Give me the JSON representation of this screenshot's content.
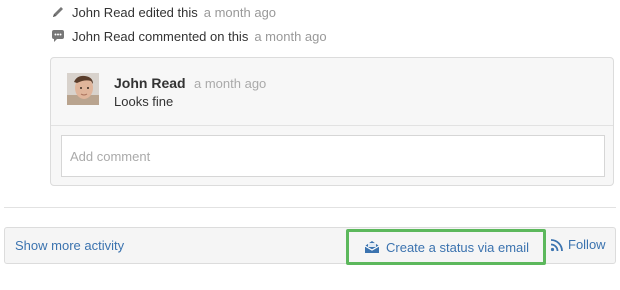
{
  "activity": [
    {
      "icon": "pencil-icon",
      "text": "John Read edited this",
      "time": "a month ago"
    },
    {
      "icon": "comment-icon",
      "text": "John Read commented on this",
      "time": "a month ago"
    }
  ],
  "comment": {
    "author": "John Read",
    "time": "a month ago",
    "body": "Looks fine",
    "avatar_icon": "user-avatar"
  },
  "add_comment": {
    "placeholder": "Add comment"
  },
  "footer": {
    "show_more_label": "Show more activity",
    "status_email_label": "Create a status via email",
    "status_email_icon": "envelope-icon",
    "follow_label": "Follow",
    "follow_icon": "rss-icon",
    "highlight_color": "#5cb85c",
    "link_color": "#3b73af"
  }
}
